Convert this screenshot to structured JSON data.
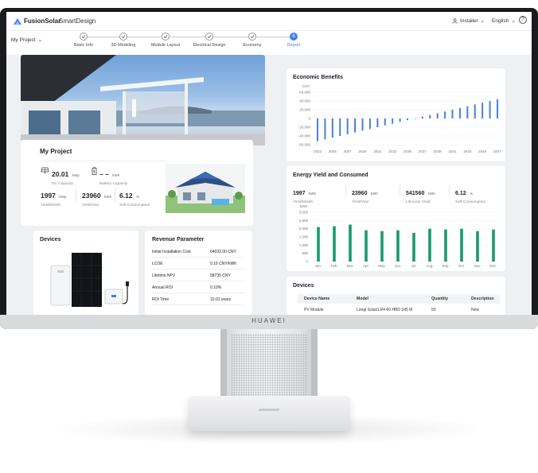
{
  "brand": "HUAWEI",
  "topbar": {
    "logo_text": "FusionSolar",
    "app_name": "SmartDesign",
    "user_label": "Installer",
    "language": "English",
    "help_glyph": "?"
  },
  "stepbar": {
    "project_label": "My Project",
    "steps": [
      {
        "label": "Basic Info",
        "state": "done"
      },
      {
        "label": "3D Modeling",
        "state": "done"
      },
      {
        "label": "Module Layout",
        "state": "done"
      },
      {
        "label": "Electrical Design",
        "state": "done"
      },
      {
        "label": "Economy",
        "state": "done"
      },
      {
        "label": "Report",
        "state": "active",
        "number": "6"
      }
    ]
  },
  "project": {
    "title": "My Project",
    "dc_capacity": {
      "value": "20.01",
      "unit": "kWp",
      "label": "DC Capacity"
    },
    "battery_capacity": {
      "value": "– –",
      "unit": "kWh",
      "label": "Battery Capacity"
    },
    "yield_month": {
      "value": "1997",
      "unit": "kWp",
      "label": "Yield/Month"
    },
    "yield_year": {
      "value": "23960",
      "unit": "kWh",
      "label": "Yield/Year"
    },
    "self_consumption": {
      "value": "6.12",
      "unit": "%",
      "label": "Self-Consumption"
    }
  },
  "devices": {
    "title": "Devices"
  },
  "revenue": {
    "title": "Revenue Parameter",
    "rows": [
      {
        "label": "Initial Installation Cost",
        "value": "64032.00 CNY"
      },
      {
        "label": "LCOE",
        "value": "0.16 CNY/kWh"
      },
      {
        "label": "Lifetime NPV",
        "value": "58735 CNY"
      },
      {
        "label": "Annual ROI",
        "value": "0.10%"
      },
      {
        "label": "ROI Time",
        "value": "10.01 years"
      }
    ]
  },
  "economic": {
    "title": "Economic Benefits",
    "unit": "CNY",
    "y_ticks": [
      "60,000",
      "40,000",
      "20,000",
      "0",
      "-20,000",
      "-40,000",
      "-60,000"
    ],
    "x_ticks": [
      "2023",
      "2025",
      "2027",
      "2029",
      "2031",
      "2033",
      "2035",
      "2037",
      "2039",
      "2041",
      "2043",
      "2045",
      "2047"
    ]
  },
  "yield": {
    "title": "Energy Yield and Consumed",
    "stats": [
      {
        "value": "1997",
        "unit": "kWh",
        "label": "Yield/Month"
      },
      {
        "value": "23960",
        "unit": "kWh",
        "label": "Yield/Year"
      },
      {
        "value": "541560",
        "unit": "kWh",
        "label": "Lifecycle Yield"
      },
      {
        "value": "6.12",
        "unit": "%",
        "label": "Self-Consumption"
      }
    ],
    "unit": "kWh",
    "y_ticks": [
      "3,000",
      "2,500",
      "2,000",
      "1,500",
      "1,000",
      "500",
      "0"
    ]
  },
  "devices_table": {
    "title": "Devices",
    "headers": [
      "Device Name",
      "Model",
      "Quantity",
      "Description"
    ],
    "rows": [
      {
        "name": "PV Module",
        "model": "Longi Solar/LR4-60 HBD 345 M",
        "quantity": "50",
        "description": "New"
      }
    ]
  },
  "chart_data": [
    {
      "type": "bar",
      "title": "Economic Benefits",
      "ylabel": "CNY",
      "ylim": [
        -60000,
        60000
      ],
      "x": [
        2023,
        2024,
        2025,
        2026,
        2027,
        2028,
        2029,
        2030,
        2031,
        2032,
        2033,
        2034,
        2035,
        2036,
        2037,
        2038,
        2039,
        2040,
        2041,
        2042,
        2043,
        2044,
        2045,
        2046,
        2047
      ],
      "values": [
        -52000,
        -48000,
        -44000,
        -40000,
        -36000,
        -32000,
        -28000,
        -24000,
        -20000,
        -16000,
        -12000,
        -8000,
        -4000,
        0,
        4000,
        8000,
        12000,
        16000,
        20000,
        24000,
        28000,
        32000,
        36000,
        40000,
        44000
      ],
      "color": "#4a7fe0"
    },
    {
      "type": "bar",
      "title": "Energy Yield and Consumed",
      "ylabel": "kWh",
      "ylim": [
        0,
        3000
      ],
      "categories": [
        "Jan.",
        "Feb.",
        "Mar.",
        "Apr.",
        "May.",
        "Jun.",
        "Jul.",
        "Aug.",
        "Sep.",
        "Oct.",
        "Nov.",
        "Dec."
      ],
      "values": [
        2100,
        2150,
        2250,
        1900,
        1850,
        1900,
        1750,
        2000,
        1950,
        2000,
        1850,
        1950
      ],
      "color": "#1a9a6c"
    }
  ]
}
